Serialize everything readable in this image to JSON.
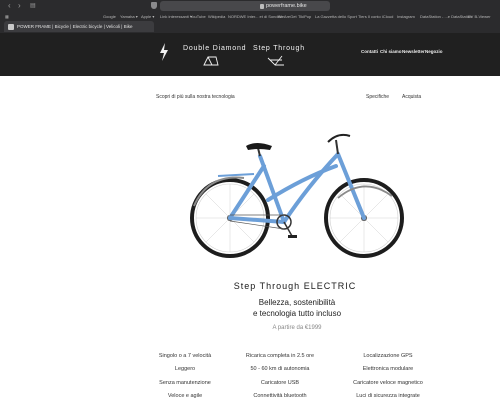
{
  "browser": {
    "url": "powerframe.bike",
    "tab_title": "POWER FRAME | Bicycle | Electric bicycle | Velicoli | Bike",
    "bookmarks": [
      "Google",
      "Yamaha ▾",
      "Apple ▾",
      "Link interessanti ▾",
      "YouTube",
      "Wikipedia",
      "NORDWE Inter... et di Sondrio",
      "WeAreGet",
      "TikiPop",
      "La Gazzetta dello Sport",
      "Tiers Il conto",
      "iCloud",
      "Instagram",
      "DataStation - ...e DataStation",
      "EV B-Viewer"
    ]
  },
  "header": {
    "logo_left": "Double Diamond",
    "logo_right": "Step Through",
    "nav": [
      "Contatti",
      "Chi siamo",
      "Newsletter",
      "Negozio"
    ]
  },
  "subnav": {
    "left": "Scopri di più sulla nostra tecnologia",
    "right": [
      "Specifiche",
      "Acquista"
    ]
  },
  "product": {
    "name_part1": "Step Through",
    "name_part2": "ELECTRIC",
    "tagline_line1": "Bellezza, sostenibilità",
    "tagline_line2": "e tecnologia tutto incluso",
    "price": "A partire da €1999"
  },
  "features": [
    [
      "Singolo o a 7 velocità",
      "Leggero",
      "Senza manutenzione",
      "Veloce e agile"
    ],
    [
      "Ricarica completa in 2.5 ore",
      "50 - 60 km di autonomia",
      "Caricatore USB",
      "Connettività bluetooth"
    ],
    [
      "Localizzazione GPS",
      "Elettronica modulare",
      "Caricatore veloce magnetico",
      "Luci di sicurezza integrate"
    ]
  ],
  "colors": {
    "header_bg": "#202020",
    "frame_blue": "#6c9fd8"
  }
}
